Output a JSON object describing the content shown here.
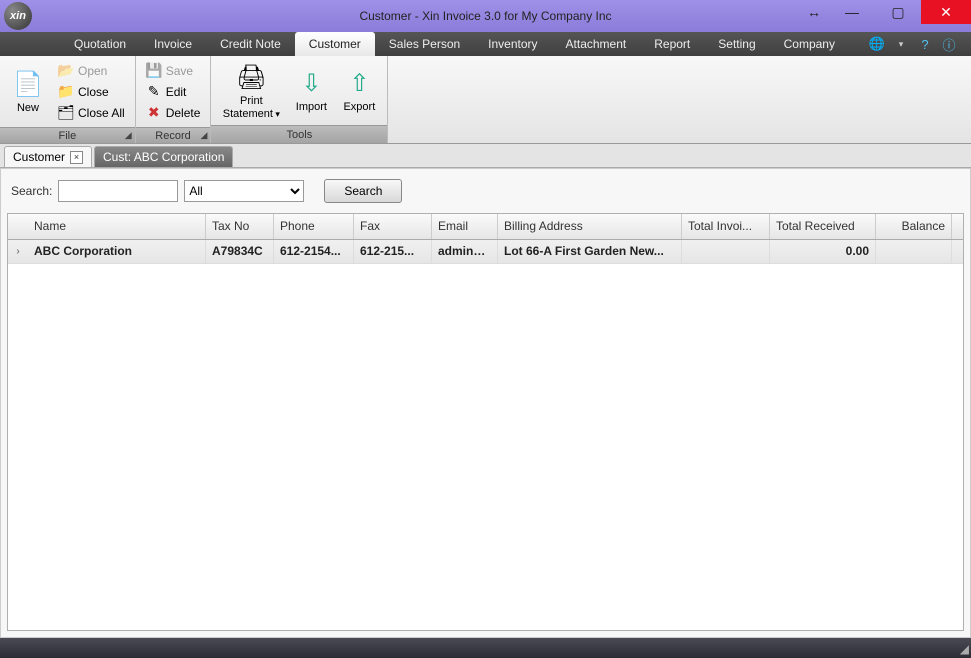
{
  "window": {
    "title": "Customer - Xin Invoice 3.0 for My Company Inc",
    "app_icon_text": "xin"
  },
  "menu": {
    "items": [
      "Quotation",
      "Invoice",
      "Credit Note",
      "Customer",
      "Sales Person",
      "Inventory",
      "Attachment",
      "Report",
      "Setting",
      "Company"
    ],
    "active_index": 3
  },
  "ribbon": {
    "file": {
      "label": "File",
      "new": "New",
      "open": "Open",
      "close": "Close",
      "close_all": "Close All"
    },
    "record": {
      "label": "Record",
      "save": "Save",
      "edit": "Edit",
      "delete": "Delete"
    },
    "tools": {
      "label": "Tools",
      "print_line1": "Print",
      "print_line2": "Statement",
      "import": "Import",
      "export": "Export"
    }
  },
  "tabs": {
    "active_label": "Customer",
    "inactive_label": "Cust: ABC Corporation"
  },
  "search": {
    "label": "Search:",
    "value": "",
    "filter": "All",
    "button": "Search"
  },
  "grid": {
    "headers": {
      "name": "Name",
      "tax": "Tax No",
      "phone": "Phone",
      "fax": "Fax",
      "email": "Email",
      "billing": "Billing Address",
      "totinv": "Total Invoi...",
      "totrec": "Total Received",
      "balance": "Balance"
    },
    "row": {
      "name": "ABC Corporation",
      "tax": "A79834C",
      "phone": "612-2154...",
      "fax": "612-215...",
      "email": "admin@...",
      "billing": "Lot 66-A First Garden New...",
      "totinv": "",
      "totrec": "0.00",
      "balance": ""
    }
  }
}
